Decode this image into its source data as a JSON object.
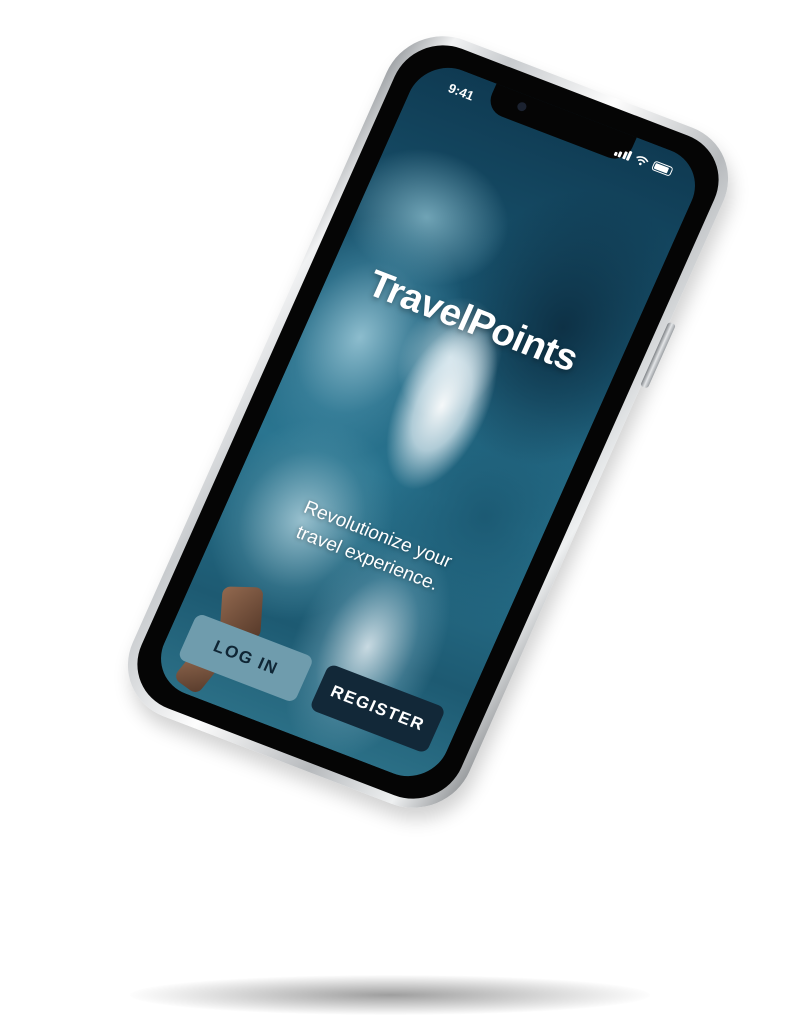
{
  "status_bar": {
    "time": "9:41"
  },
  "app": {
    "title": "TravelPoints",
    "tagline_line1": "Revolutionize your",
    "tagline_line2": "travel experience."
  },
  "actions": {
    "login_label": "LOG IN",
    "register_label": "REGISTER"
  },
  "colors": {
    "login_button": "#6f9cad",
    "register_button": "#122838",
    "ocean_dark": "#0f3a52",
    "ocean_mid": "#2a7590"
  },
  "icons": {
    "signal": "cellular-signal-icon",
    "wifi": "wifi-icon",
    "battery": "battery-icon"
  }
}
